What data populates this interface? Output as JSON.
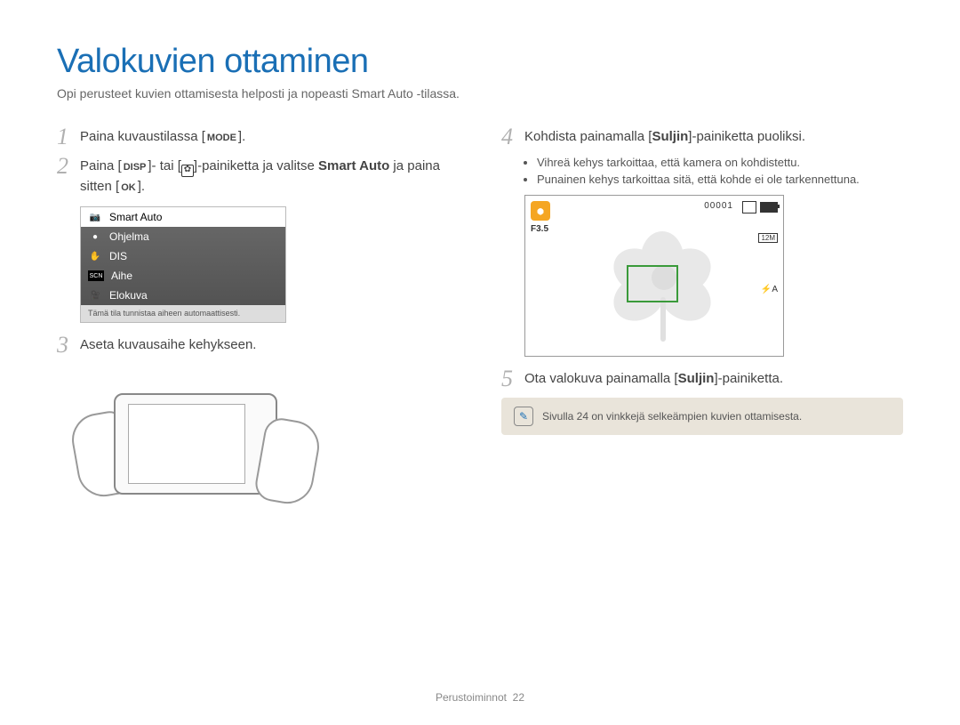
{
  "title": "Valokuvien ottaminen",
  "subtitle": "Opi perusteet kuvien ottamisesta helposti ja nopeasti Smart Auto -tilassa.",
  "steps": {
    "s1_pre": "Paina kuvaustilassa [",
    "s1_btn": "MODE",
    "s1_post": "].",
    "s2_pre": "Paina [",
    "s2_btn1": "DISP",
    "s2_mid1": "]- tai [",
    "s2_btn2": "✿",
    "s2_mid2": "]-painiketta ja valitse ",
    "s2_bold": "Smart Auto",
    "s2_mid3": " ja paina sitten [",
    "s2_btn3": "OK",
    "s2_post": "].",
    "s3": "Aseta kuvausaihe kehykseen.",
    "s4_pre": "Kohdista painamalla [",
    "s4_bold": "Suljin",
    "s4_post": "]-painiketta puoliksi.",
    "s4_b1": "Vihreä kehys tarkoittaa, että kamera on kohdistettu.",
    "s4_b2": "Punainen kehys tarkoittaa sitä, että kohde ei ole tarkennettuna.",
    "s5_pre": "Ota valokuva painamalla [",
    "s5_bold": "Suljin",
    "s5_post": "]-painiketta."
  },
  "mode_menu": {
    "items": [
      {
        "label": "Smart Auto",
        "icon": "📷",
        "selected": true
      },
      {
        "label": "Ohjelma",
        "icon": "●",
        "selected": false
      },
      {
        "label": "DIS",
        "icon": "✋",
        "selected": false
      },
      {
        "label": "Aihe",
        "icon": "SCN",
        "selected": false
      },
      {
        "label": "Elokuva",
        "icon": "🎥",
        "selected": false
      }
    ],
    "desc": "Tämä tila tunnistaa aiheen automaattisesti."
  },
  "lcd": {
    "counter": "00001",
    "fvalue": "F3.5",
    "res": "12M",
    "flash": "⚡A"
  },
  "tip": "Sivulla 24 on vinkkejä selkeämpien kuvien ottamisesta.",
  "footer": {
    "section": "Perustoiminnot",
    "page": "22"
  }
}
